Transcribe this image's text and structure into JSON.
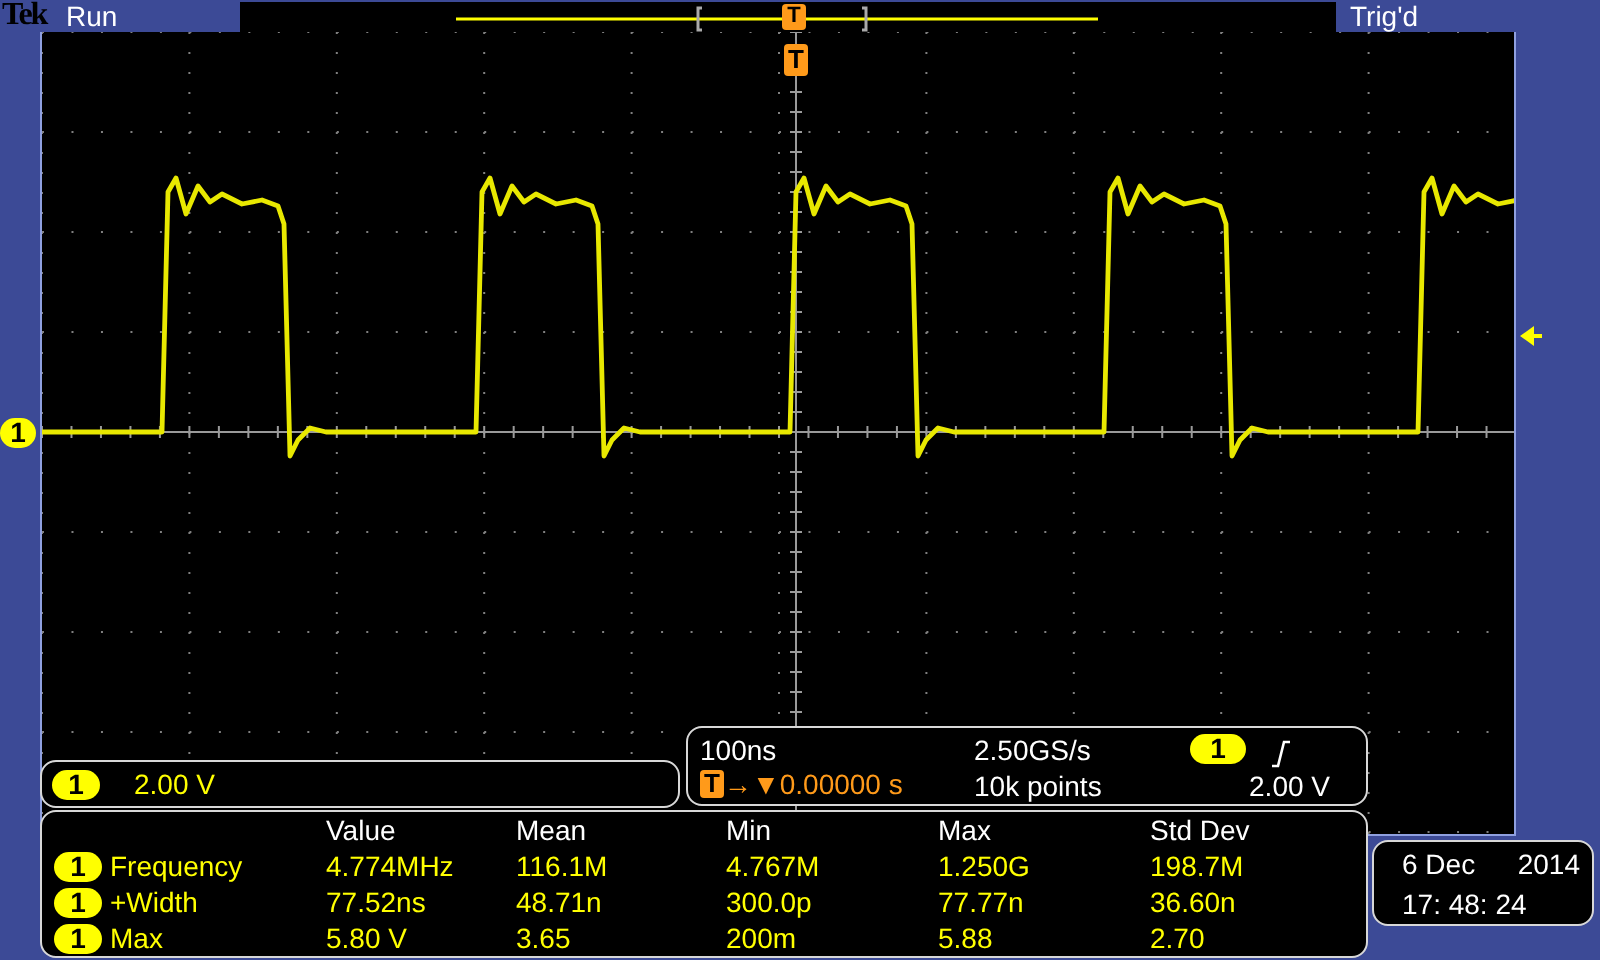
{
  "top_bar": {
    "brand": "Tek",
    "run_state": "Run",
    "trigger_status": "Trig'd"
  },
  "record_view": {
    "trigger_mark": "T"
  },
  "graticule": {
    "trigger_mark": "T",
    "channel_mark": "1"
  },
  "channel_scale": {
    "channel": "1",
    "scale": "2.00 V"
  },
  "timebase": {
    "time_per_div": "100ns",
    "sample_rate": "2.50GS/s",
    "record_length": "10k points",
    "delay_badge": "T",
    "delay_arrow": "→▼",
    "delay": "0.00000 s",
    "trigger_channel": "1",
    "trigger_level": "2.00 V"
  },
  "measurements": {
    "columns": [
      "Value",
      "Mean",
      "Min",
      "Max",
      "Std Dev"
    ],
    "rows": [
      {
        "channel": "1",
        "name": "Frequency",
        "values": [
          "4.774MHz",
          "116.1M",
          "4.767M",
          "1.250G",
          "198.7M"
        ]
      },
      {
        "channel": "1",
        "name": "+Width",
        "values": [
          "77.52ns",
          "48.71n",
          "300.0p",
          "77.77n",
          "36.60n"
        ]
      },
      {
        "channel": "1",
        "name": "Max",
        "values": [
          "5.80 V",
          "3.65",
          "200m",
          "5.88",
          "2.70"
        ]
      }
    ]
  },
  "clock": {
    "date": "6 Dec",
    "year": "2014",
    "time": "17: 48: 24"
  }
}
